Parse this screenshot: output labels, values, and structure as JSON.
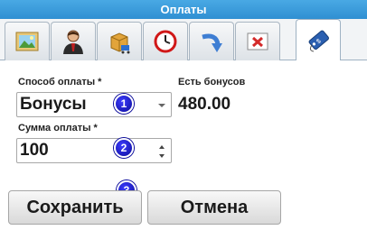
{
  "window": {
    "title": "Оплаты"
  },
  "tabs": [
    {
      "name": "tab-image",
      "icon": "image-icon"
    },
    {
      "name": "tab-person",
      "icon": "person-icon"
    },
    {
      "name": "tab-products",
      "icon": "box-cart-icon"
    },
    {
      "name": "tab-clock",
      "icon": "clock-icon"
    },
    {
      "name": "tab-return",
      "icon": "return-arrow-icon"
    },
    {
      "name": "tab-delete",
      "icon": "delete-icon"
    },
    {
      "name": "tab-payments",
      "icon": "price-tag-icon",
      "active": true
    }
  ],
  "form": {
    "payment_method_label": "Способ оплаты *",
    "payment_method_value": "Бонусы",
    "bonus_label": "Есть бонусов",
    "bonus_value": "480.00",
    "amount_label": "Сумма оплаты *",
    "amount_value": "100"
  },
  "markers": [
    "1",
    "2",
    "3"
  ],
  "buttons": {
    "save": "Сохранить",
    "cancel": "Отмена"
  },
  "colors": {
    "titlebar": "#2f8fd2",
    "marker": "#0b0b9a"
  }
}
